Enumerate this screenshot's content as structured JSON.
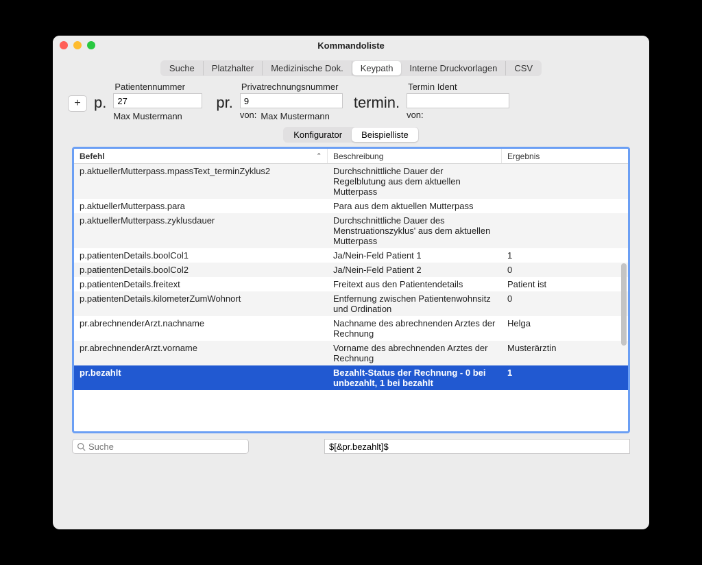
{
  "window": {
    "title": "Kommandoliste"
  },
  "main_tabs": {
    "items": [
      "Suche",
      "Platzhalter",
      "Medizinische Dok.",
      "Keypath",
      "Interne Druckvorlagen",
      "CSV"
    ],
    "active_index": 3
  },
  "fields": {
    "patient": {
      "label": "Patientennummer",
      "prefix": "p.",
      "value": "27",
      "sub": "Max Mustermann"
    },
    "invoice": {
      "label": "Privatrechnungsnummer",
      "prefix": "pr.",
      "value": "9",
      "sub_pre": "von:",
      "sub": "Max Mustermann"
    },
    "termin": {
      "label": "Termin Ident",
      "prefix": "termin.",
      "value": "",
      "sub_pre": "von:",
      "sub": ""
    }
  },
  "inner_tabs": {
    "items": [
      "Konfigurator",
      "Beispielliste"
    ],
    "active_index": 1
  },
  "table": {
    "headers": {
      "befehl": "Befehl",
      "beschreibung": "Beschreibung",
      "ergebnis": "Ergebnis"
    },
    "rows": [
      {
        "befehl": "p.aktuellerMutterpass.mpassText_terminZyklus2",
        "beschreibung": "Durchschnittliche Dauer der Regelblutung aus dem aktuellen Mutterpass",
        "ergebnis": ""
      },
      {
        "befehl": "p.aktuellerMutterpass.para",
        "beschreibung": "Para aus dem aktuellen Mutterpass",
        "ergebnis": ""
      },
      {
        "befehl": "p.aktuellerMutterpass.zyklusdauer",
        "beschreibung": "Durchschnittliche Dauer des Menstruationszyklus' aus dem aktuellen Mutterpass",
        "ergebnis": ""
      },
      {
        "befehl": "p.patientenDetails.boolCol1",
        "beschreibung": "Ja/Nein-Feld Patient 1",
        "ergebnis": "1"
      },
      {
        "befehl": "p.patientenDetails.boolCol2",
        "beschreibung": "Ja/Nein-Feld Patient 2",
        "ergebnis": "0"
      },
      {
        "befehl": "p.patientenDetails.freitext",
        "beschreibung": "Freitext aus den Patientendetails",
        "ergebnis": "Patient ist"
      },
      {
        "befehl": "p.patientenDetails.kilometerZumWohnort",
        "beschreibung": "Entfernung zwischen Patientenwohnsitz und Ordination",
        "ergebnis": "0"
      },
      {
        "befehl": "pr.abrechnenderArzt.nachname",
        "beschreibung": "Nachname des abrechnenden Arztes der Rechnung",
        "ergebnis": "Helga"
      },
      {
        "befehl": "pr.abrechnenderArzt.vorname",
        "beschreibung": "Vorname des abrechnenden Arztes der Rechnung",
        "ergebnis": "Musterärztin"
      },
      {
        "befehl": "pr.bezahlt",
        "beschreibung": "Bezahlt-Status der Rechnung - 0 bei unbezahlt, 1 bei bezahlt",
        "ergebnis": "1"
      }
    ],
    "selected_index": 9
  },
  "search": {
    "placeholder": "Suche"
  },
  "result_expression": "$[&pr.bezahlt]$"
}
